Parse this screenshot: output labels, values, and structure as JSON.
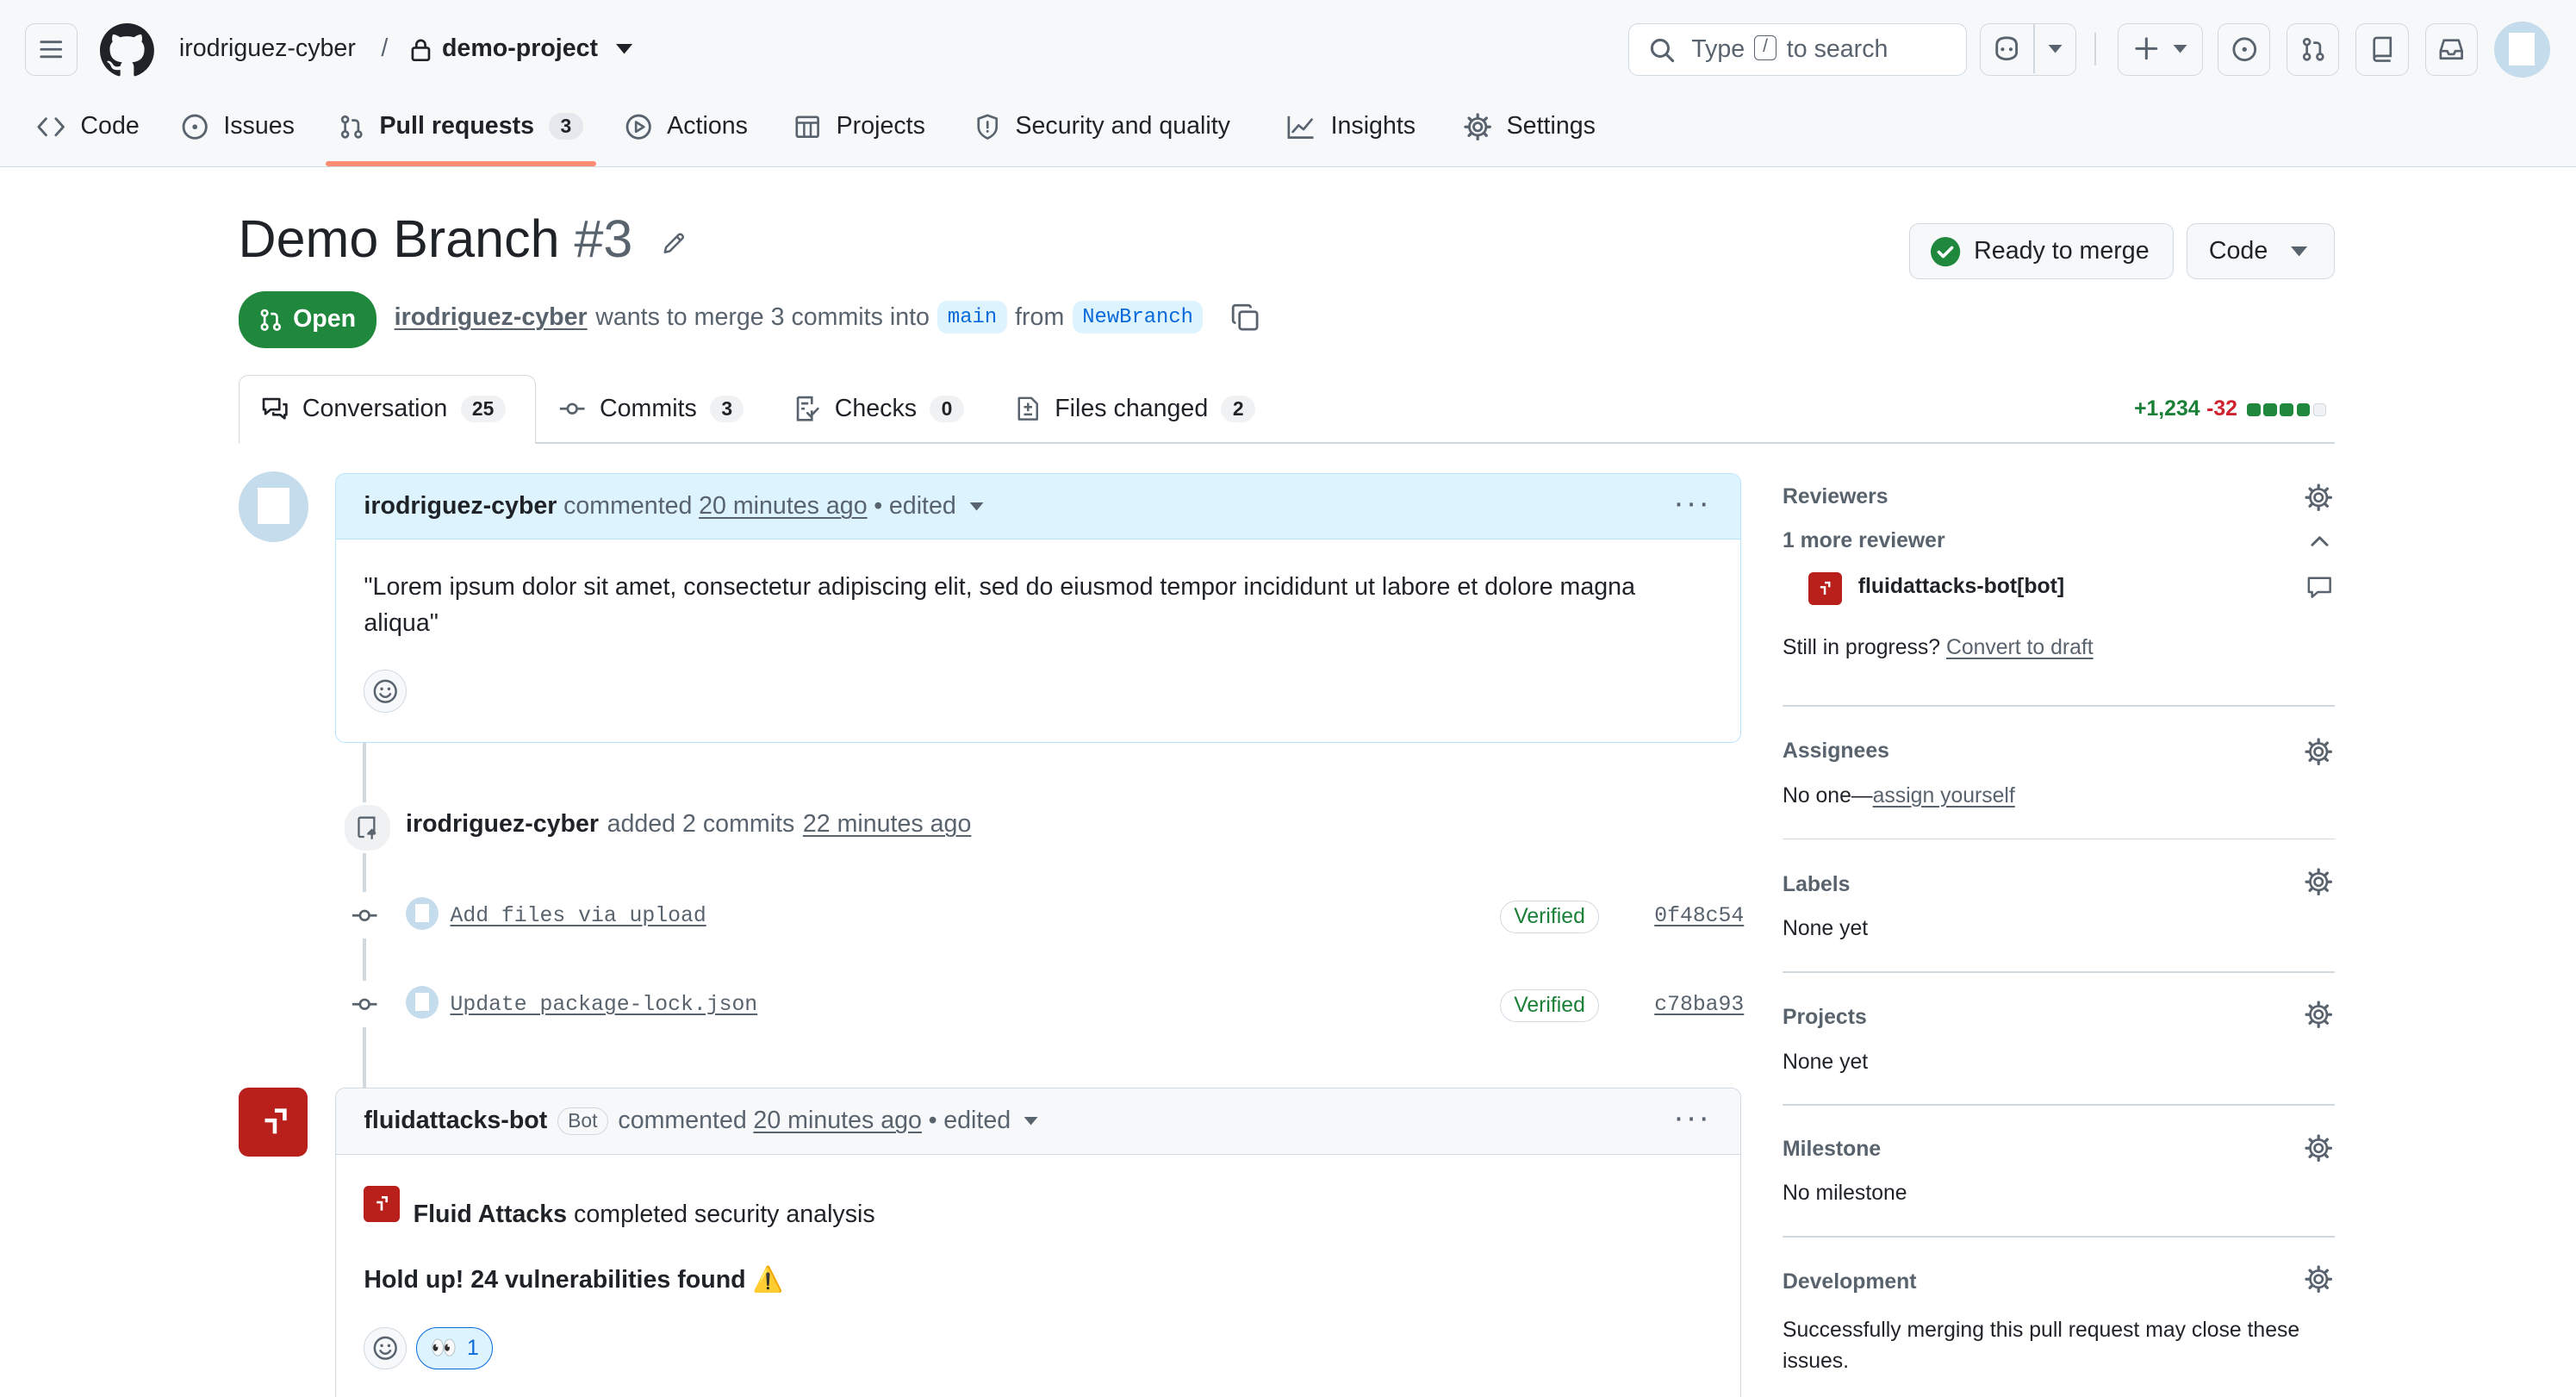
{
  "header": {
    "owner": "irodriguez-cyber",
    "separator": "/",
    "repo": "demo-project",
    "search_prefix": "Type",
    "search_key": "/",
    "search_suffix": "to search"
  },
  "nav": {
    "code": "Code",
    "issues": "Issues",
    "pull_requests": "Pull requests",
    "pull_requests_count": "3",
    "actions": "Actions",
    "projects": "Projects",
    "security": "Security and quality",
    "insights": "Insights",
    "settings": "Settings"
  },
  "pr": {
    "title": "Demo Branch",
    "number": "#3",
    "state": "Open",
    "author": "irodriguez-cyber",
    "merge_text": "wants to merge 3 commits into",
    "base": "main",
    "from": "from",
    "head": "NewBranch",
    "ready_label": "Ready to merge",
    "code_label": "Code"
  },
  "subtabs": {
    "conversation": "Conversation",
    "conversation_count": "25",
    "commits": "Commits",
    "commits_count": "3",
    "checks": "Checks",
    "checks_count": "0",
    "files": "Files changed",
    "files_count": "2",
    "additions": "+1,234",
    "deletions": "-32"
  },
  "comment1": {
    "author": "irodriguez-cyber",
    "action": "commented",
    "time": "20 minutes ago",
    "sep": "•",
    "edited": "edited",
    "body": "\"Lorem ipsum dolor sit amet, consectetur adipiscing elit, sed do eiusmod tempor incididunt ut labore et dolore magna aliqua\""
  },
  "push_event": {
    "author": "irodriguez-cyber",
    "action": "added 2 commits",
    "time": "22 minutes ago"
  },
  "commits": [
    {
      "message": "Add files via upload",
      "badge": "Verified",
      "sha": "0f48c54"
    },
    {
      "message": "Update package-lock.json",
      "badge": "Verified",
      "sha": "c78ba93"
    }
  ],
  "comment2": {
    "author": "fluidattacks-bot",
    "bot_label": "Bot",
    "action": "commented",
    "time": "20 minutes ago",
    "sep": "•",
    "edited": "edited",
    "brand": "Fluid Attacks",
    "line1": "completed security analysis",
    "line2": "Hold up! 24 vulnerabilities found",
    "line2_emoji": "⚠️",
    "reaction_emoji": "👀",
    "reaction_count": "1"
  },
  "sidebar": {
    "reviewers_title": "Reviewers",
    "more_reviewer": "1 more reviewer",
    "reviewer_name": "fluidattacks-bot[bot]",
    "draft_prefix": "Still in progress?",
    "draft_link": "Convert to draft",
    "assignees_title": "Assignees",
    "assignees_prefix": "No one—",
    "assignees_link": "assign yourself",
    "labels_title": "Labels",
    "labels_value": "None yet",
    "projects_title": "Projects",
    "projects_value": "None yet",
    "milestone_title": "Milestone",
    "milestone_value": "No milestone",
    "development_title": "Development",
    "development_value": "Successfully merging this pull request may close these issues."
  },
  "colors": {
    "open_green": "#1f883d",
    "link_blue": "#0969da",
    "fluid_red": "#b9201c",
    "deletion_red": "#cf222e",
    "addition_green": "#1a7f37"
  },
  "icons": {
    "menu": "hamburger-icon",
    "logo": "github-mark-icon",
    "lock": "lock-icon",
    "copilot": "copilot-icon",
    "plus": "plus-icon",
    "issue": "issue-opened-icon",
    "pr": "git-pull-request-icon",
    "notifications": "inbox-icon"
  }
}
